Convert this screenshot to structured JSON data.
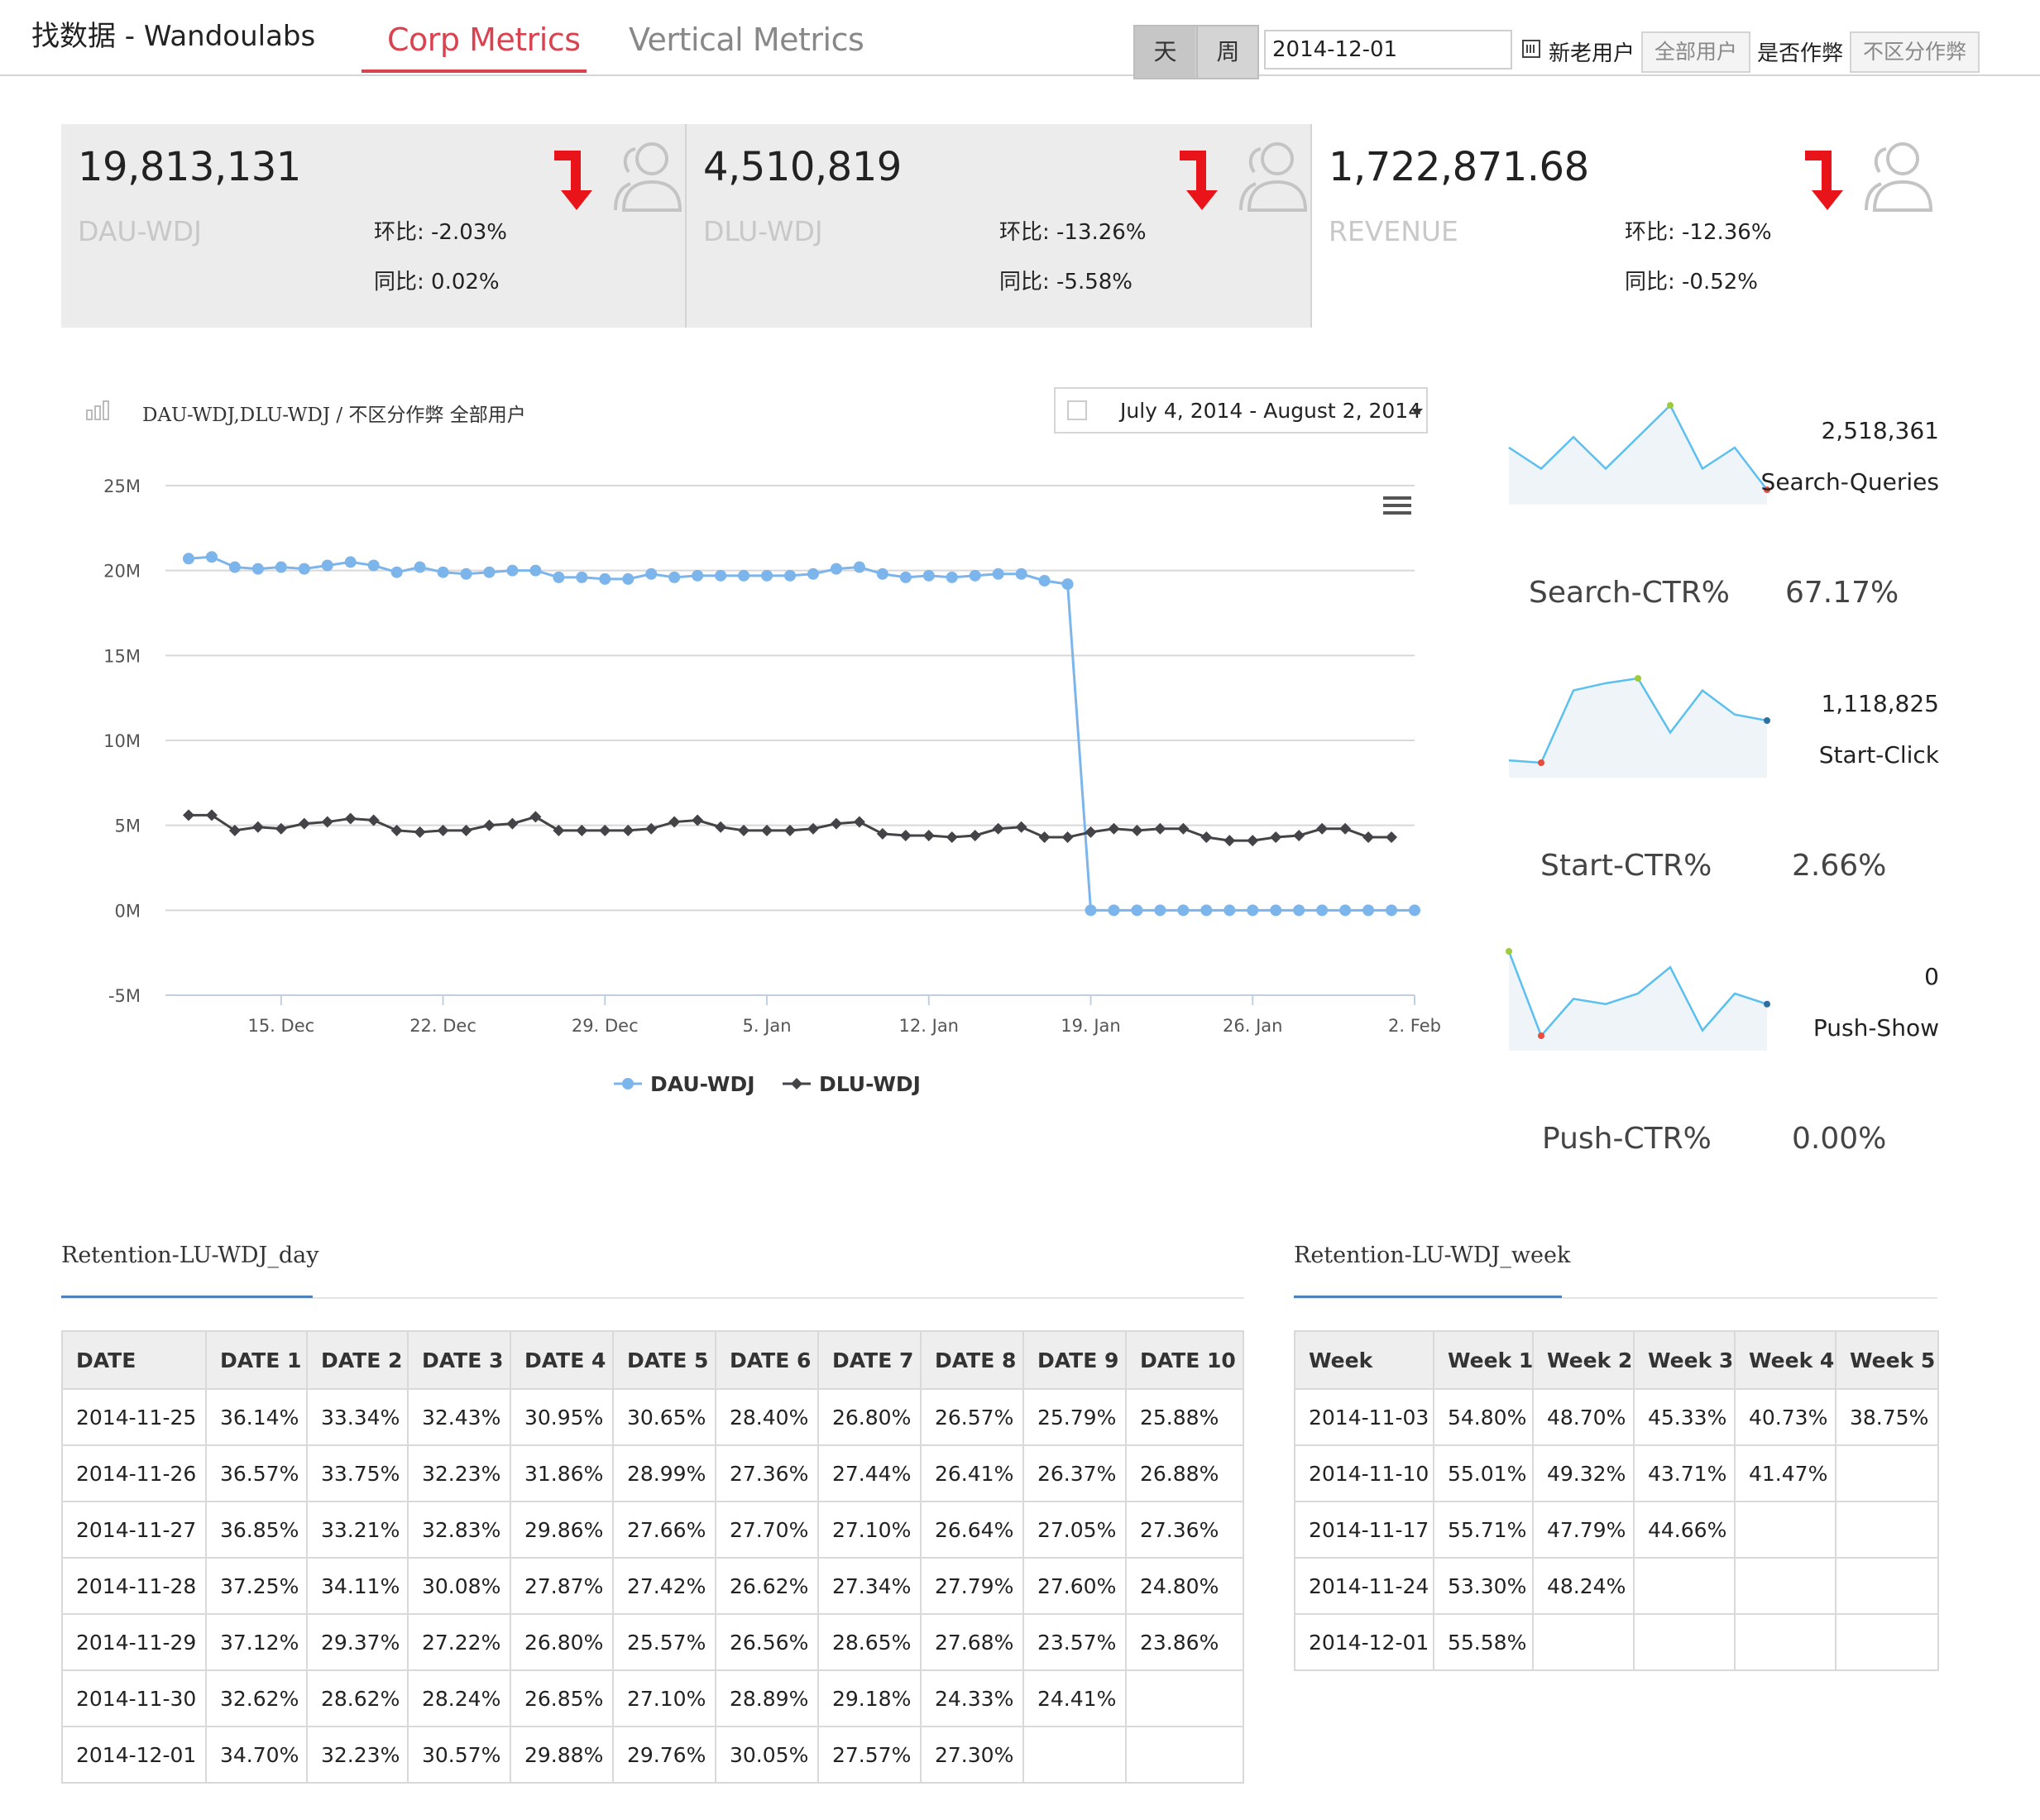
{
  "app": {
    "brand": "找数据 - Wandoulabs",
    "tabs": [
      {
        "label": "Corp Metrics",
        "active": true
      },
      {
        "label": "Vertical Metrics",
        "active": false
      }
    ]
  },
  "controls": {
    "granularity": [
      {
        "label": "天",
        "active": true
      },
      {
        "label": "周",
        "active": false
      }
    ],
    "date_value": "2014-12-01",
    "new_old_label": "新老用户",
    "user_filter": "全部用户",
    "cheat_label": "是否作弊",
    "cheat_filter": "不区分作弊"
  },
  "kpis": [
    {
      "value": "19,813,131",
      "name": "DAU-WDJ",
      "hb_label": "环比:",
      "hb": "-2.03%",
      "tb_label": "同比:",
      "tb": "0.02%",
      "trend": "down"
    },
    {
      "value": "4,510,819",
      "name": "DLU-WDJ",
      "hb_label": "环比:",
      "hb": "-13.26%",
      "tb_label": "同比:",
      "tb": "-5.58%",
      "trend": "down"
    },
    {
      "value": "1,722,871.68",
      "name": "REVENUE",
      "hb_label": "环比:",
      "hb": "-12.36%",
      "tb_label": "同比:",
      "tb": "-0.52%",
      "trend": "down"
    }
  ],
  "colors": {
    "accent_red": "#d9434f",
    "arrow_red": "#e8141a",
    "series_blue": "#7cb5ec",
    "series_dark": "#434348",
    "spark_line": "#5bc0f0",
    "spark_fill": "#eef4f8"
  },
  "chart_panel": {
    "title": "DAU-WDJ,DLU-WDJ / 不区分作弊 全部用户",
    "date_range": "July 4, 2014 - August 2, 2014",
    "menu_icon": "hamburger-icon"
  },
  "chart_data": {
    "type": "line",
    "x_start": "2014-12-10",
    "x_end": "2015-02-02",
    "x_tick_labels": [
      "15. Dec",
      "22. Dec",
      "29. Dec",
      "5. Jan",
      "12. Jan",
      "19. Jan",
      "26. Jan",
      "2. Feb"
    ],
    "y_tick_labels": [
      "25M",
      "20M",
      "15M",
      "10M",
      "5M",
      "0M",
      "-5M"
    ],
    "ylim": [
      -5,
      25
    ],
    "y_unit": "M",
    "grid": true,
    "legend_position": "bottom-center",
    "series": [
      {
        "name": "DAU-WDJ",
        "values": [
          20.7,
          20.8,
          20.2,
          20.1,
          20.2,
          20.1,
          20.3,
          20.5,
          20.3,
          19.9,
          20.2,
          19.9,
          19.8,
          19.9,
          20.0,
          20.0,
          19.6,
          19.6,
          19.5,
          19.5,
          19.8,
          19.6,
          19.7,
          19.7,
          19.7,
          19.7,
          19.7,
          19.8,
          20.1,
          20.2,
          19.8,
          19.6,
          19.7,
          19.6,
          19.7,
          19.8,
          19.8,
          19.4,
          19.2,
          0,
          0,
          0,
          0,
          0,
          0,
          0,
          0,
          0,
          0,
          0,
          0,
          0,
          0,
          0
        ]
      },
      {
        "name": "DLU-WDJ",
        "values": [
          5.6,
          5.6,
          4.7,
          4.9,
          4.8,
          5.1,
          5.2,
          5.4,
          5.3,
          4.7,
          4.6,
          4.7,
          4.7,
          5.0,
          5.1,
          5.5,
          4.7,
          4.7,
          4.7,
          4.7,
          4.8,
          5.2,
          5.3,
          4.9,
          4.7,
          4.7,
          4.7,
          4.8,
          5.1,
          5.2,
          4.5,
          4.4,
          4.4,
          4.3,
          4.4,
          4.8,
          4.9,
          4.3,
          4.3,
          4.6,
          4.8,
          4.7,
          4.8,
          4.8,
          4.3,
          4.1,
          4.1,
          4.3,
          4.4,
          4.8,
          4.8,
          4.3,
          4.3
        ]
      }
    ]
  },
  "sparklines": [
    {
      "value": "2,518,361",
      "label": "Search-Queries",
      "ctr_label": "Search-CTR%",
      "ctr_value": "67.17%",
      "values": [
        5,
        3,
        6,
        3,
        6,
        9,
        3,
        5,
        1
      ],
      "peak_index": 5,
      "end_color": "#e74c3c"
    },
    {
      "value": "1,118,825",
      "label": "Start-Click",
      "ctr_label": "Start-CTR%",
      "ctr_value": "2.66%",
      "values": [
        1.2,
        1,
        7,
        7.6,
        8,
        3.5,
        7,
        5,
        4.5
      ],
      "peak_index": 4,
      "low_index": 1,
      "end_color": "#2c6fa0"
    },
    {
      "value": "0",
      "label": "Push-Show",
      "ctr_label": "Push-CTR%",
      "ctr_value": "0.00%",
      "values": [
        8,
        0,
        3.5,
        3,
        4,
        6.5,
        0.5,
        4,
        3
      ],
      "peak_index": 0,
      "low_index": 1,
      "end_color": "#2c6fa0"
    }
  ],
  "retention_day": {
    "title": "Retention-LU-WDJ_day",
    "headers": [
      "DATE",
      "DATE 1",
      "DATE 2",
      "DATE 3",
      "DATE 4",
      "DATE 5",
      "DATE 6",
      "DATE 7",
      "DATE 8",
      "DATE 9",
      "DATE 10"
    ],
    "rows": [
      [
        "2014-11-25",
        "36.14%",
        "33.34%",
        "32.43%",
        "30.95%",
        "30.65%",
        "28.40%",
        "26.80%",
        "26.57%",
        "25.79%",
        "25.88%"
      ],
      [
        "2014-11-26",
        "36.57%",
        "33.75%",
        "32.23%",
        "31.86%",
        "28.99%",
        "27.36%",
        "27.44%",
        "26.41%",
        "26.37%",
        "26.88%"
      ],
      [
        "2014-11-27",
        "36.85%",
        "33.21%",
        "32.83%",
        "29.86%",
        "27.66%",
        "27.70%",
        "27.10%",
        "26.64%",
        "27.05%",
        "27.36%"
      ],
      [
        "2014-11-28",
        "37.25%",
        "34.11%",
        "30.08%",
        "27.87%",
        "27.42%",
        "26.62%",
        "27.34%",
        "27.79%",
        "27.60%",
        "24.80%"
      ],
      [
        "2014-11-29",
        "37.12%",
        "29.37%",
        "27.22%",
        "26.80%",
        "25.57%",
        "26.56%",
        "28.65%",
        "27.68%",
        "23.57%",
        "23.86%"
      ],
      [
        "2014-11-30",
        "32.62%",
        "28.62%",
        "28.24%",
        "26.85%",
        "27.10%",
        "28.89%",
        "29.18%",
        "24.33%",
        "24.41%",
        ""
      ],
      [
        "2014-12-01",
        "34.70%",
        "32.23%",
        "30.57%",
        "29.88%",
        "29.76%",
        "30.05%",
        "27.57%",
        "27.30%",
        "",
        ""
      ]
    ]
  },
  "retention_week": {
    "title": "Retention-LU-WDJ_week",
    "headers": [
      "Week",
      "Week 1",
      "Week 2",
      "Week 3",
      "Week 4",
      "Week 5"
    ],
    "rows": [
      [
        "2014-11-03",
        "54.80%",
        "48.70%",
        "45.33%",
        "40.73%",
        "38.75%"
      ],
      [
        "2014-11-10",
        "55.01%",
        "49.32%",
        "43.71%",
        "41.47%",
        ""
      ],
      [
        "2014-11-17",
        "55.71%",
        "47.79%",
        "44.66%",
        "",
        ""
      ],
      [
        "2014-11-24",
        "53.30%",
        "48.24%",
        "",
        "",
        ""
      ],
      [
        "2014-12-01",
        "55.58%",
        "",
        "",
        "",
        ""
      ]
    ]
  }
}
